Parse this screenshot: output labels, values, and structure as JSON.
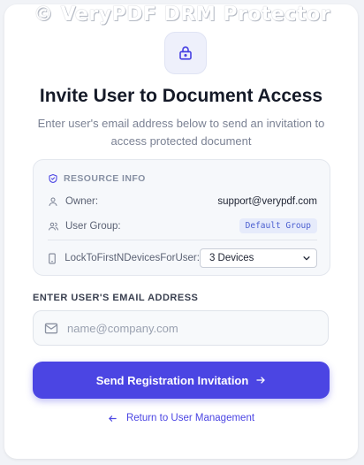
{
  "watermark": "© VeryPDF DRM Protector",
  "header": {
    "title": "Invite User to Document Access",
    "subtitle": "Enter user's email address below to send an invitation to access protected document"
  },
  "resource_info": {
    "heading": "RESOURCE INFO",
    "owner_label": "Owner:",
    "owner_value": "support@verypdf.com",
    "group_label": "User Group:",
    "group_value": "Default Group",
    "lock_label": "LockToFirstNDevicesForUser:",
    "lock_selected": "3 Devices"
  },
  "email": {
    "label": "ENTER USER'S EMAIL ADDRESS",
    "placeholder": "name@company.com",
    "value": ""
  },
  "actions": {
    "send_label": "Send Registration Invitation",
    "back_label": "Return to User Management"
  },
  "colors": {
    "accent": "#4b45e3",
    "badge_bg": "#e6ebfb"
  },
  "icons": {
    "lock": "lock-icon",
    "shield": "shield-check-icon",
    "user": "user-icon",
    "users": "users-icon",
    "device": "device-icon",
    "mail": "mail-icon",
    "arrow_right": "arrow-right-icon",
    "arrow_left": "arrow-left-icon"
  }
}
